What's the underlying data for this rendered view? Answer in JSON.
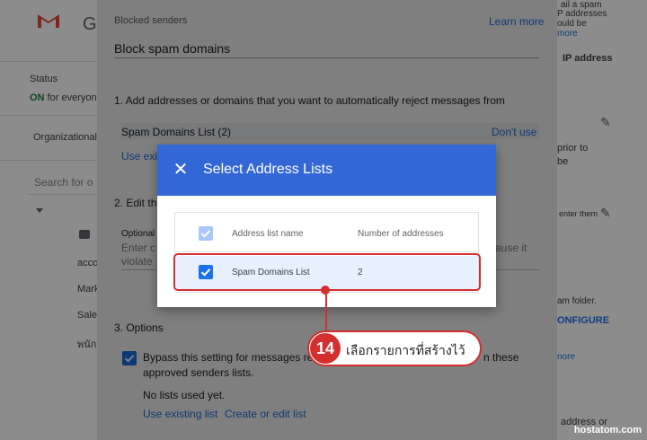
{
  "background": {
    "left": {
      "app_initial": "G",
      "status_label": "Status",
      "status_value": "ON",
      "status_suffix": "for everyone",
      "org_label": "Organizational",
      "search_placeholder": "Search for o",
      "items": [
        "acco",
        "Mark",
        "Sales",
        "พนัก"
      ]
    },
    "right": {
      "lines": [
        "ail a spam",
        "P addresses",
        "ould be",
        "more",
        "IP address",
        "prior to",
        "be",
        "enter them",
        "am folder.",
        "ONFIGURE",
        "nore",
        "address or"
      ]
    }
  },
  "settings": {
    "top_label": "Blocked senders",
    "learn_more": "Learn more",
    "setting_name": "Block spam domains",
    "step1": "1. Add addresses or domains that you want to automatically reject messages from",
    "list_row_name": "Spam Domains List (2)",
    "dont_use": "Don't use",
    "use_existing_fragment": "Use exis",
    "step2_fragment": "2. Edit the",
    "optional_fragment": "Optional",
    "placeholder_frag_left": "Enter c",
    "placeholder_frag_left2": "violate",
    "placeholder_frag_right": "ause it",
    "step3": "3. Options",
    "bypass_text_a": "Bypass this setting for messages rec",
    "bypass_text_b": "n these",
    "bypass_text_c": "approved senders lists.",
    "no_lists": "No lists used yet.",
    "use_existing_list": "Use existing list",
    "create_edit_list": "Create or edit list"
  },
  "modal": {
    "title": "Select Address Lists",
    "close_icon": "close-icon",
    "columns": [
      "Address list name",
      "Number of addresses"
    ],
    "rows": [
      {
        "name": "Spam Domains List",
        "count": "2",
        "checked": true
      }
    ]
  },
  "annotation": {
    "step_number": "14",
    "step_text": "เลือกรายการที่สร้างไว้",
    "color": "#d32f2f"
  },
  "watermark": "hostatom.com",
  "colors": {
    "header_blue": "#3367d6",
    "checkbox_blue": "#1a73e8",
    "link_blue": "#1a73e8",
    "row_highlight": "#e8f0fe"
  }
}
